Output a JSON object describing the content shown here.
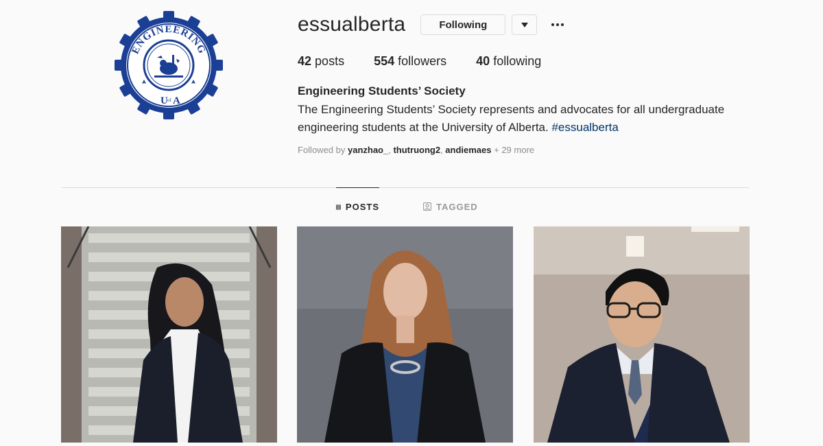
{
  "profile": {
    "username": "essualberta",
    "avatar_icon": "engineering-gear-logo",
    "avatar_text_top": "ENGINEERING",
    "avatar_text_bottom_u": "U",
    "avatar_text_bottom_of": "of",
    "avatar_text_bottom_a": "A"
  },
  "actions": {
    "following_label": "Following",
    "dropdown_icon": "caret-down-icon",
    "more_icon": "more-options-icon"
  },
  "stats": {
    "posts_count": "42",
    "posts_label": "posts",
    "followers_count": "554",
    "followers_label": "followers",
    "following_count": "40",
    "following_label": "following"
  },
  "bio": {
    "name": "Engineering Students’ Society",
    "text": "The Engineering Students’ Society represents and advocates for all undergraduate engineering students at the University of Alberta. ",
    "hashtag": "#essualberta"
  },
  "followed_by": {
    "prefix": "Followed by ",
    "users": [
      "yanzhao_",
      "thutruong2",
      "andiemaes"
    ],
    "separator": ", ",
    "more": " + 29 more"
  },
  "tabs": [
    {
      "label": "POSTS",
      "icon": "grid-icon",
      "active": true
    },
    {
      "label": "TAGGED",
      "icon": "tagged-person-icon",
      "active": false
    }
  ],
  "posts": [
    {
      "description": "portrait-woman-stairs"
    },
    {
      "description": "portrait-woman-gray-background"
    },
    {
      "description": "portrait-man-glasses"
    }
  ],
  "colors": {
    "brand_blue": "#1b3f94",
    "hashtag": "#003569",
    "text": "#262626",
    "muted": "#8e8e8e"
  }
}
